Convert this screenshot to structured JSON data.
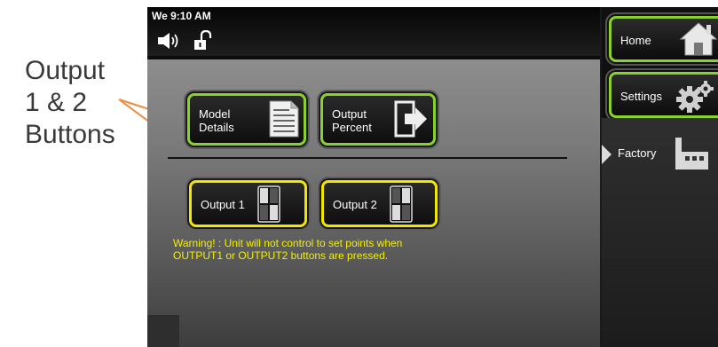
{
  "annotation": {
    "lines": [
      "Output",
      "1 & 2",
      "Buttons"
    ],
    "arrow_color": "#f08a3c"
  },
  "statusbar": {
    "time": "We 9:10 AM",
    "icons": [
      "speaker-icon",
      "unlock-icon"
    ]
  },
  "main": {
    "buttons": {
      "model_details": {
        "line1": "Model",
        "line2": "Details",
        "icon": "document-icon"
      },
      "output_percent": {
        "line1": "Output",
        "line2": "Percent",
        "icon": "output-arrow-icon"
      },
      "output1": {
        "label": "Output 1",
        "icon": "switch-icon"
      },
      "output2": {
        "label": "Output 2",
        "icon": "switch-icon"
      }
    },
    "warning": {
      "line1": "Warning! : Unit will not control to set points when",
      "line2": "OUTPUT1 or OUTPUT2 buttons are pressed."
    }
  },
  "nav": {
    "home": {
      "label": "Home",
      "icon": "home-icon"
    },
    "settings": {
      "label": "Settings",
      "icon": "gears-icon"
    },
    "factory": {
      "label": "Factory",
      "icon": "factory-icon",
      "active": true
    }
  },
  "colors": {
    "green_border": "#8ad12e",
    "yellow_border": "#f2e500",
    "warning_text": "#f2f000"
  }
}
